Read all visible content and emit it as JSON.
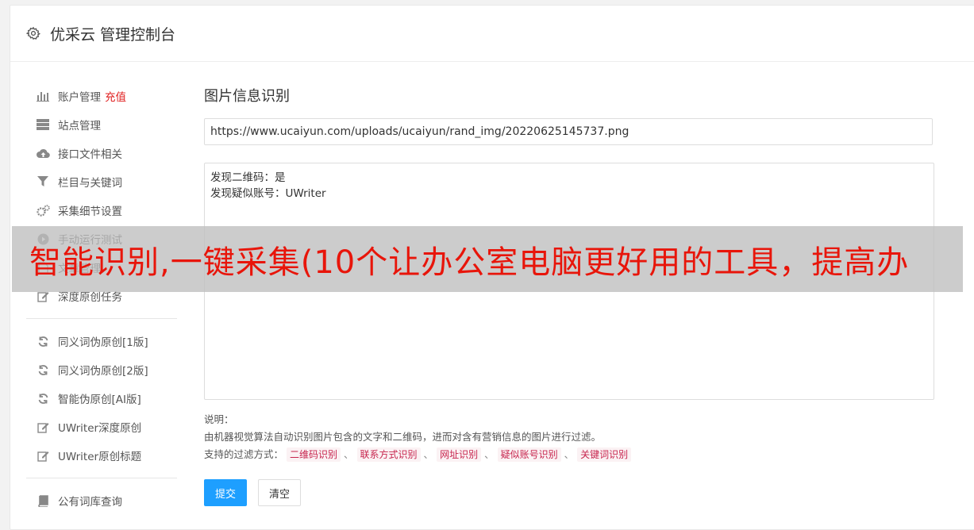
{
  "header": {
    "title": "优采云 管理控制台",
    "icon": "gear-icon"
  },
  "sidebar": {
    "groups": [
      [
        {
          "icon": "bar-chart-icon",
          "label": "账户管理",
          "extra": "充值"
        },
        {
          "icon": "server-icon",
          "label": "站点管理"
        },
        {
          "icon": "cloud-upload-icon",
          "label": "接口文件相关"
        },
        {
          "icon": "filter-icon",
          "label": "栏目与关键词"
        },
        {
          "icon": "cogs-icon",
          "label": "采集细节设置"
        },
        {
          "icon": "play-circle-icon",
          "label": "手动运行测试"
        },
        {
          "icon": "file-icon",
          "label": "文章管理"
        },
        {
          "icon": "edit-icon",
          "label": "深度原创任务"
        }
      ],
      [
        {
          "icon": "refresh-icon",
          "label": "同义词伪原创[1版]"
        },
        {
          "icon": "refresh-icon",
          "label": "同义词伪原创[2版]"
        },
        {
          "icon": "refresh-icon",
          "label": "智能伪原创[AI版]"
        },
        {
          "icon": "edit-icon",
          "label": "UWriter深度原创"
        },
        {
          "icon": "edit-icon",
          "label": "UWriter原创标题"
        }
      ],
      [
        {
          "icon": "book-icon",
          "label": "公有词库查询"
        }
      ]
    ]
  },
  "main": {
    "title": "图片信息识别",
    "url_value": "https://www.ucaiyun.com/uploads/ucaiyun/rand_img/20220625145737.png",
    "result_lines": [
      "发现二维码：是",
      "发现疑似账号：UWriter"
    ],
    "desc_label": "说明：",
    "desc_text": "由机器视觉算法自动识别图片包含的文字和二维码，进而对含有营销信息的图片进行过滤。",
    "filter_label": "支持的过滤方式：",
    "filter_tags": [
      "二维码识别",
      "联系方式识别",
      "网址识别",
      "疑似账号识别",
      "关键词识别"
    ],
    "filter_separator": "、",
    "submit_label": "提交",
    "clear_label": "清空"
  },
  "banner": {
    "text": "智能识别,一键采集(10个让办公室电脑更好用的工具，提高办"
  },
  "colors": {
    "primary": "#1e9fff",
    "recharge": "#e02020",
    "tag_text": "#c7254e",
    "banner_text": "#e8150a"
  }
}
